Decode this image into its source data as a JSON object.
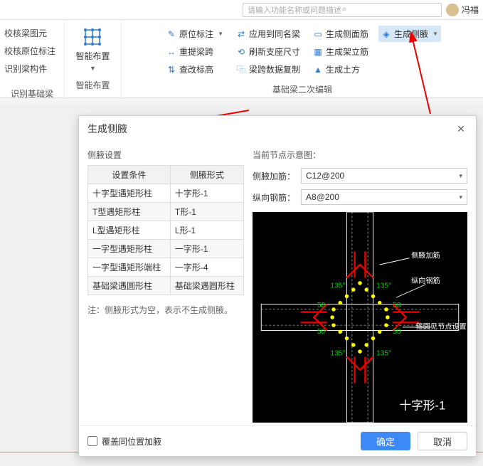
{
  "search": {
    "placeholder": "请输入功能名称或问题描述"
  },
  "user": {
    "name": "冯福"
  },
  "side": {
    "items": [
      "校核梁图元",
      "校核原位标注",
      "识别梁构件"
    ],
    "title": "识别基础梁"
  },
  "smart": {
    "label": "智能布置",
    "title": "智能布置"
  },
  "ribbon": {
    "row1": [
      "原位标注",
      "应用到同名梁",
      "生成侧面筋",
      "生成侧腋"
    ],
    "row2": [
      "重提梁跨",
      "刷新支座尺寸",
      "生成架立筋",
      ""
    ],
    "row3": [
      "查改标高",
      "梁跨数据复制",
      "生成土方",
      ""
    ],
    "title": "基础梁二次编辑"
  },
  "dialog": {
    "title": "生成侧腋",
    "leftTitle": "侧腋设置",
    "cols": [
      "设置条件",
      "侧腋形式"
    ],
    "rows": [
      [
        "十字型遇矩形柱",
        "十字形-1"
      ],
      [
        "T型遇矩形柱",
        "T形-1"
      ],
      [
        "L型遇矩形柱",
        "L形-1"
      ],
      [
        "一字型遇矩形柱",
        "一字形-1"
      ],
      [
        "一字型遇矩形端柱",
        "一字形-4"
      ],
      [
        "基础梁遇圆形柱",
        "基础梁遇圆形柱"
      ]
    ],
    "note": "注：侧腋形式为空，表示不生成侧腋。",
    "rightTitle": "当前节点示意图：",
    "fields": {
      "jiajin": {
        "label": "侧腋加筋：",
        "value": "C12@200"
      },
      "gangjin": {
        "label": "纵向钢筋：",
        "value": "A8@200"
      }
    },
    "diag": {
      "lbl_jiajin": "侧腋加筋",
      "lbl_gangjin": "纵向钢筋",
      "lbl_detail": "箍圆见节点设置",
      "shape": "十字形-1",
      "ang": "135°",
      "len": "50"
    },
    "checkbox": "覆盖同位置加腋",
    "ok": "确定",
    "cancel": "取消"
  }
}
